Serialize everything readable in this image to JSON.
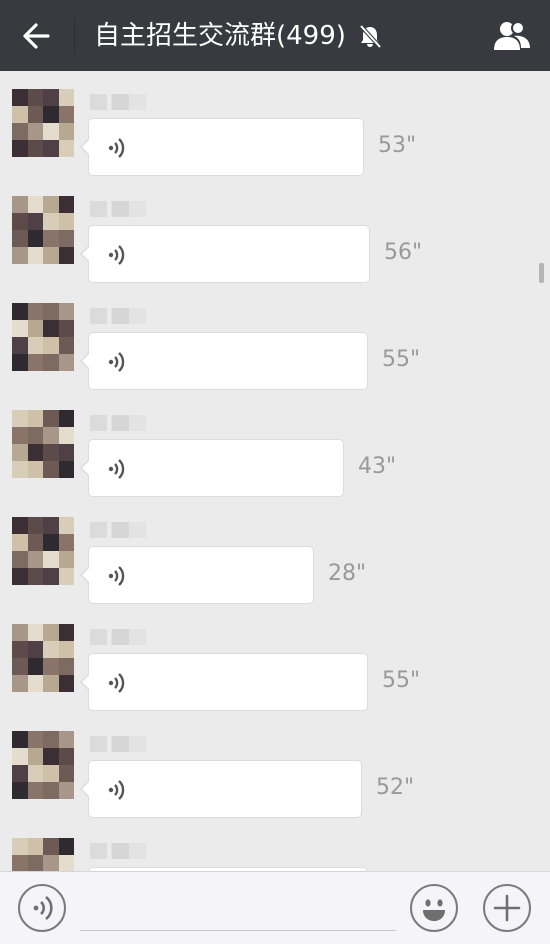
{
  "header": {
    "title": "自主招生交流群(499)",
    "icons": {
      "back": "back-arrow-icon",
      "mute": "bell-muted-icon",
      "group": "group-members-icon"
    }
  },
  "messages": [
    {
      "duration": "53\"",
      "voice_level": 0.53
    },
    {
      "duration": "56\"",
      "voice_level": 0.56
    },
    {
      "duration": "55\"",
      "voice_level": 0.55
    },
    {
      "duration": "43\"",
      "voice_level": 0.43
    },
    {
      "duration": "28\"",
      "voice_level": 0.28
    },
    {
      "duration": "55\"",
      "voice_level": 0.55
    },
    {
      "duration": "52\"",
      "voice_level": 0.52
    },
    {
      "duration": "",
      "voice_level": 0.55
    }
  ],
  "inputbar": {
    "placeholder": "",
    "icons": {
      "voice": "voice-input-icon",
      "emoji": "emoji-smile-icon",
      "plus": "plus-icon"
    }
  },
  "colors": {
    "header_bg": "#393a3f",
    "chat_bg": "#ebebeb",
    "bubble_bg": "#ffffff",
    "duration_text": "#999999"
  }
}
